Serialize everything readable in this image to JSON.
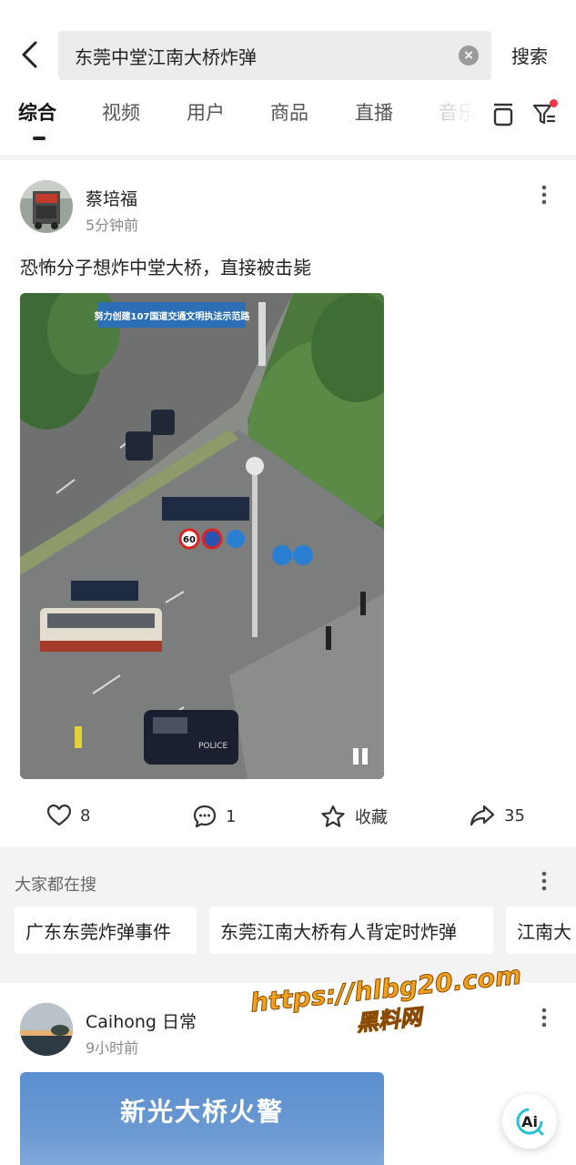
{
  "search": {
    "query": "东莞中堂江南大桥炸弹",
    "button_label": "搜索"
  },
  "tabs": [
    {
      "label": "综合",
      "active": true
    },
    {
      "label": "视频",
      "active": false
    },
    {
      "label": "用户",
      "active": false
    },
    {
      "label": "商品",
      "active": false
    },
    {
      "label": "直播",
      "active": false
    },
    {
      "label": "音乐",
      "active": false
    }
  ],
  "post": {
    "author": "蔡培福",
    "time": "5分钟前",
    "text": "恐怖分子想炸中堂大桥，直接被击毙",
    "image": {
      "banner_text": "努力创建107国道交通文明执法示范路",
      "speed_sign": "60",
      "van_text": "POLICE"
    },
    "likes": "8",
    "comments": "1",
    "favorite_label": "收藏",
    "shares": "35"
  },
  "suggestions": {
    "title": "大家都在搜",
    "items": [
      "广东东莞炸弹事件",
      "东莞江南大桥有人背定时炸弹",
      "江南大"
    ]
  },
  "post2": {
    "author": "Caihong 日常",
    "time": "9小时前",
    "image_text": "新光大桥火警"
  },
  "watermark": {
    "url": "https://hlbg20.com",
    "name": "黑料网"
  },
  "ai_button": "Ai",
  "colors": {
    "accent_red": "#f2364c",
    "watermark_orange": "#f0a21e"
  }
}
